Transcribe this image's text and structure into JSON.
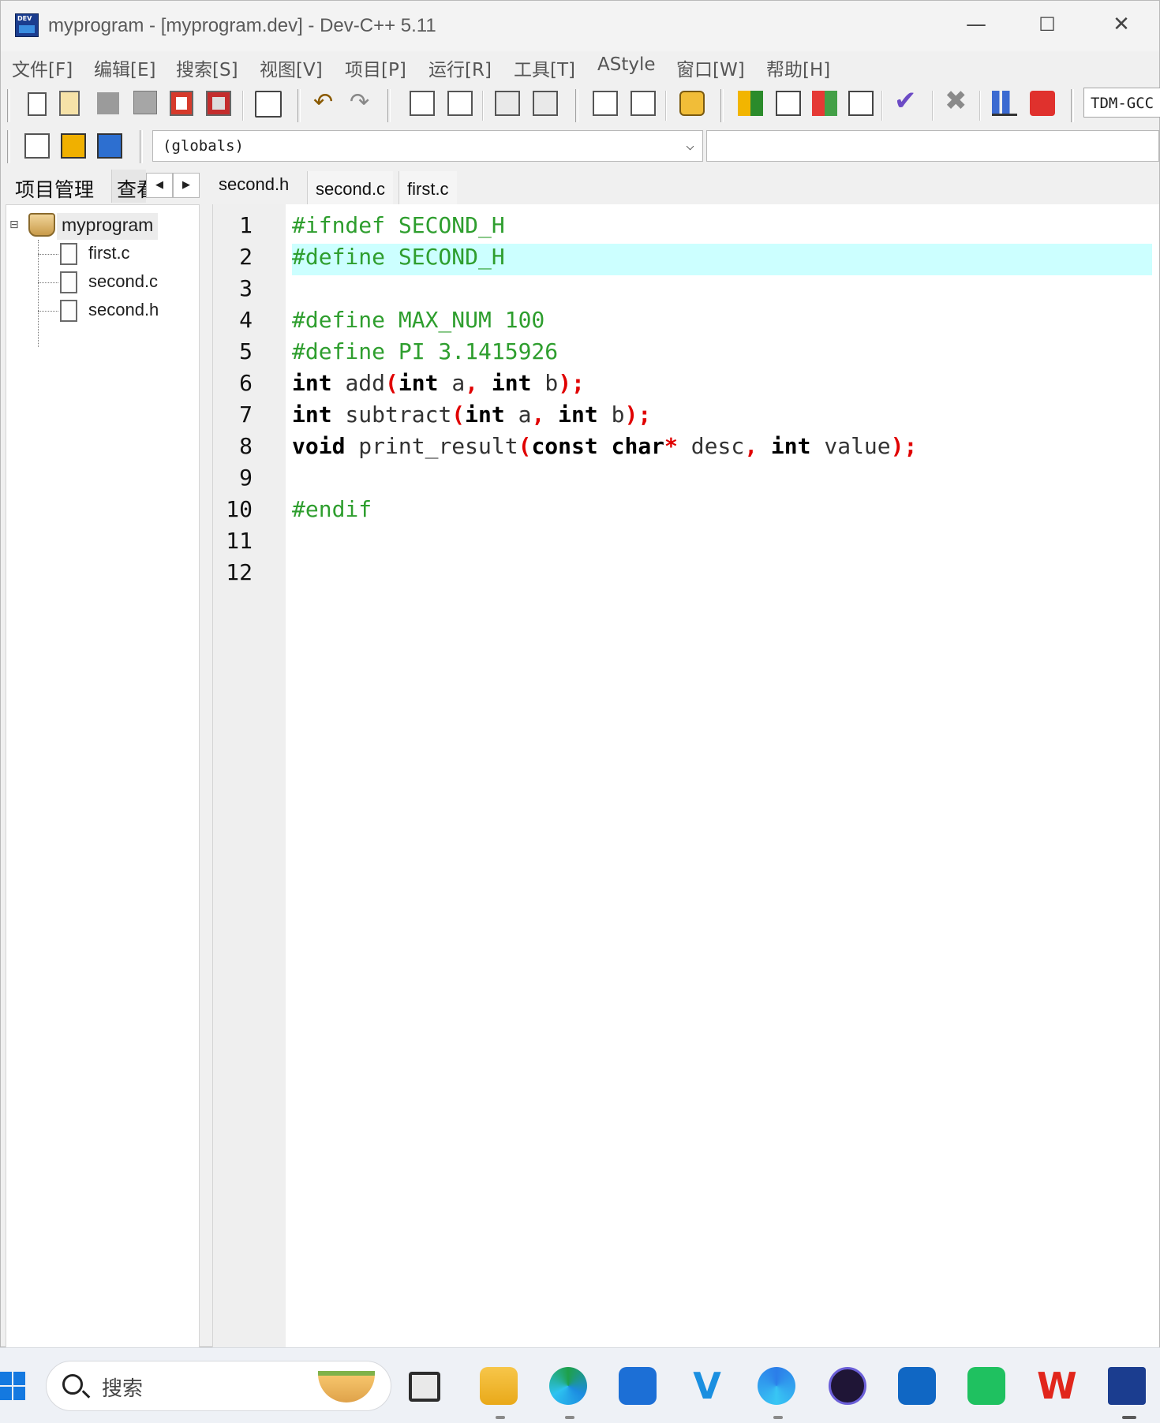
{
  "window": {
    "title": "myprogram - [myprogram.dev] - Dev-C++ 5.11",
    "minimize": "—",
    "maximize": "☐",
    "close": "✕"
  },
  "menu": [
    "文件[F]",
    "编辑[E]",
    "搜索[S]",
    "视图[V]",
    "项目[P]",
    "运行[R]",
    "工具[T]",
    "AStyle",
    "窗口[W]",
    "帮助[H]"
  ],
  "toolbar": {
    "compiler": "TDM-GCC",
    "scope_select": "(globals)"
  },
  "left_panel": {
    "tab_project": "项目管理",
    "tab_class": "查看类",
    "project_name": "myprogram",
    "files": [
      "first.c",
      "second.c",
      "second.h"
    ]
  },
  "editor": {
    "tabs": [
      "second.h",
      "second.c",
      "first.c"
    ],
    "active_tab": "second.h",
    "active_line": 2,
    "line_numbers": [
      "1",
      "2",
      "3",
      "4",
      "5",
      "6",
      "7",
      "8",
      "9",
      "10",
      "11",
      "12"
    ],
    "lines": [
      "#ifndef SECOND_H",
      "#define SECOND_H",
      "",
      "#define MAX_NUM 100",
      "#define PI 3.1415926",
      "int add(int a, int b);",
      "int subtract(int a, int b);",
      "void print_result(const char* desc, int value);",
      "",
      "#endif",
      "",
      ""
    ]
  },
  "taskbar": {
    "search_placeholder": "搜索",
    "apps": [
      "task-view",
      "file-explorer",
      "edge",
      "microsoft-store",
      "vscode-like-app",
      "edge-ai",
      "ai-assistant",
      "outlook-new",
      "wechat",
      "wps",
      "dev-cpp"
    ]
  },
  "colors": {
    "preprocessor": "#2e9e2e",
    "symbol": "#e00000",
    "active_line": "#ccffff"
  }
}
